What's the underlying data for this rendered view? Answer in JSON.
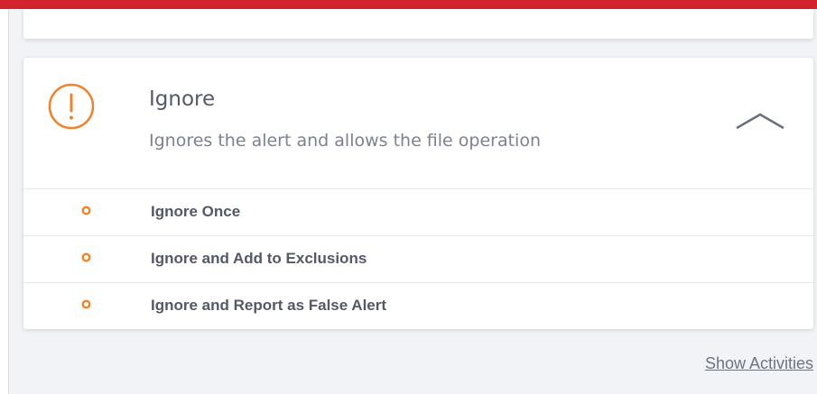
{
  "colors": {
    "accent": "#f0822a",
    "top_bar": "#d2232e",
    "text_primary": "#55596a",
    "text_secondary": "#7d8190",
    "background": "#f2f3f7"
  },
  "icons": {
    "alert": "exclamation-circle-icon",
    "collapse": "chevron-up-icon",
    "option_bullet": "circle-bullet-icon"
  },
  "action_card": {
    "title": "Ignore",
    "subtitle": "Ignores the alert and allows the file operation",
    "options": [
      {
        "label": "Ignore Once"
      },
      {
        "label": "Ignore and Add to Exclusions"
      },
      {
        "label": "Ignore and Report as False Alert"
      }
    ]
  },
  "footer": {
    "show_activities_label": "Show Activities"
  }
}
